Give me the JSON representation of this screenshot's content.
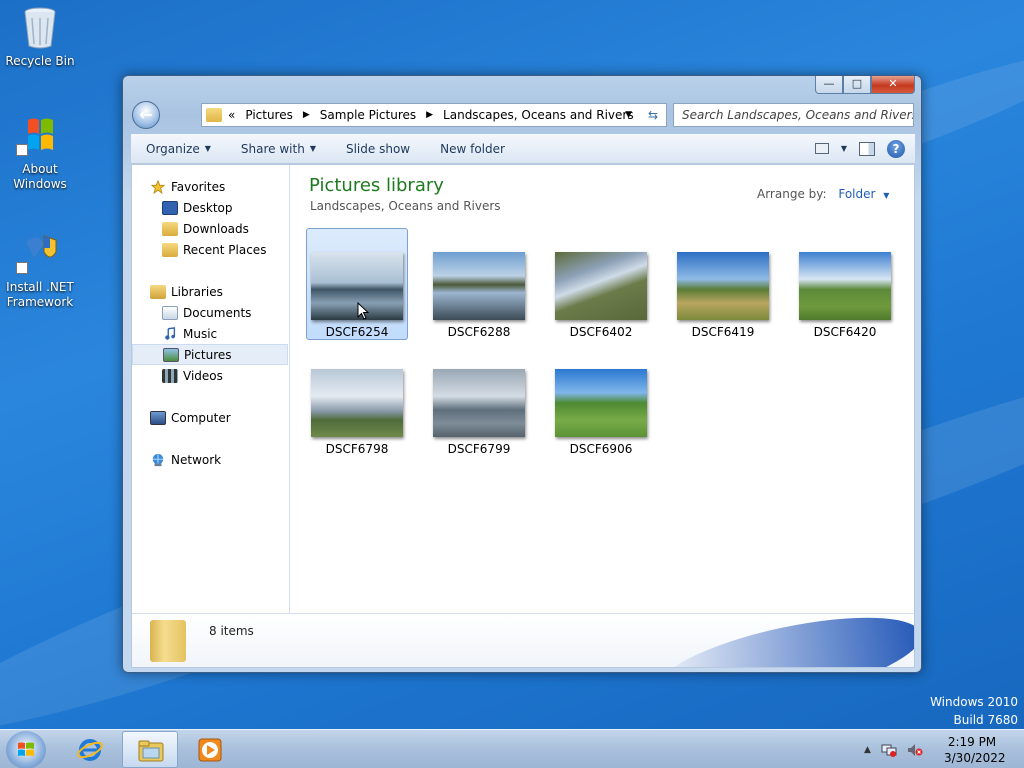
{
  "desktop": {
    "icons": [
      {
        "label": "Recycle Bin"
      },
      {
        "label": "About Windows"
      },
      {
        "label": "Install .NET Framework"
      }
    ],
    "watermark": {
      "line1": "Windows 2010",
      "line2": "Build 7680"
    }
  },
  "window": {
    "controls": {
      "minimize": "—",
      "maximize": "□",
      "close": "✕"
    },
    "back_label": "←",
    "address": {
      "lead": "«",
      "crumbs": [
        "Pictures",
        "Sample Pictures",
        "Landscapes, Oceans and Rivers"
      ],
      "separator": "▶",
      "dropdown": "▼",
      "refresh": "⇆"
    },
    "search": {
      "placeholder": "Search Landscapes, Oceans and Rivers"
    },
    "toolbar": {
      "organize": "Organize",
      "share_with": "Share with",
      "slide_show": "Slide show",
      "new_folder": "New folder",
      "caret": "▼",
      "help": "?"
    },
    "nav": {
      "favorites": "Favorites",
      "desktop": "Desktop",
      "downloads": "Downloads",
      "recent_places": "Recent Places",
      "libraries": "Libraries",
      "documents": "Documents",
      "music": "Music",
      "pictures": "Pictures",
      "videos": "Videos",
      "computer": "Computer",
      "network": "Network"
    },
    "library": {
      "title": "Pictures library",
      "subtitle": "Landscapes, Oceans and Rivers",
      "arrange_label": "Arrange by:",
      "arrange_value": "Folder",
      "caret": "▼"
    },
    "files": [
      {
        "name": "DSCF6254"
      },
      {
        "name": "DSCF6288"
      },
      {
        "name": "DSCF6402"
      },
      {
        "name": "DSCF6419"
      },
      {
        "name": "DSCF6420"
      },
      {
        "name": "DSCF6798"
      },
      {
        "name": "DSCF6799"
      },
      {
        "name": "DSCF6906"
      }
    ],
    "details": {
      "count": "8 items"
    }
  },
  "taskbar": {
    "clock_time": "2:19 PM",
    "clock_date": "3/30/2022",
    "tray_expand": "▲"
  }
}
